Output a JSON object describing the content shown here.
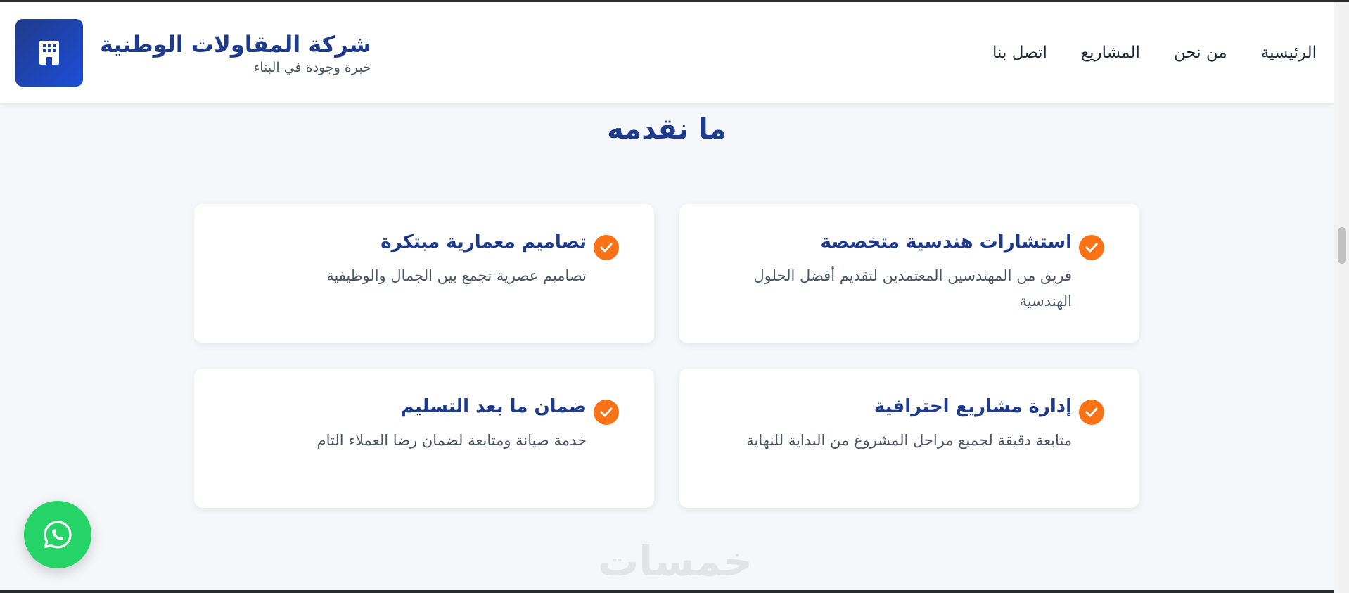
{
  "header": {
    "brand_name": "شركة المقاولات الوطنية",
    "brand_tagline": "خبرة وجودة في البناء",
    "nav": [
      {
        "label": "الرئيسية"
      },
      {
        "label": "من نحن"
      },
      {
        "label": "المشاريع"
      },
      {
        "label": "اتصل بنا"
      }
    ]
  },
  "services": {
    "title": "ما نقدمه",
    "cards": [
      {
        "title": "استشارات هندسية متخصصة",
        "description": "فريق من المهندسين المعتمدين لتقديم أفضل الحلول الهندسية"
      },
      {
        "title": "تصاميم معمارية مبتكرة",
        "description": "تصاميم عصرية تجمع بين الجمال والوظيفية"
      },
      {
        "title": "إدارة مشاريع احترافية",
        "description": "متابعة دقيقة لجميع مراحل المشروع من البداية للنهاية"
      },
      {
        "title": "ضمان ما بعد التسليم",
        "description": "خدمة صيانة ومتابعة لضمان رضا العملاء التام"
      }
    ]
  },
  "watermark": "خمسات",
  "icons": {
    "logo": "building-icon",
    "card_marker": "check-circle-icon",
    "floating_button": "whatsapp-icon"
  },
  "colors": {
    "primary": "#1e3a8a",
    "accent": "#f97316",
    "whatsapp": "#25d366",
    "background": "#f5f7fa"
  }
}
